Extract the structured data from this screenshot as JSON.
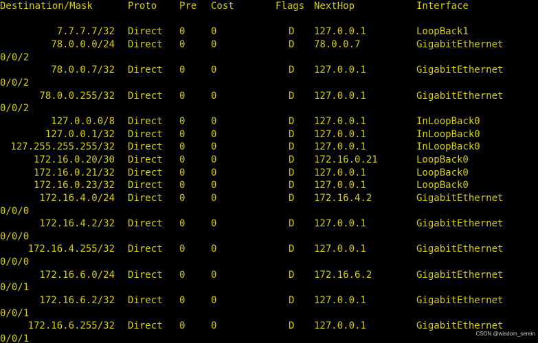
{
  "header": {
    "destination": "Destination/Mask",
    "proto": "Proto",
    "pre": "Pre",
    "cost": "Cost",
    "flags": "Flags",
    "nexthop": "NextHop",
    "interface": "Interface"
  },
  "routes": [
    {
      "dest": "7.7.7.7/32",
      "proto": "Direct",
      "pre": "0",
      "cost": "0",
      "flags": "D",
      "nexthop": "127.0.0.1",
      "iface": "LoopBack1",
      "wrap": ""
    },
    {
      "dest": "78.0.0.0/24",
      "proto": "Direct",
      "pre": "0",
      "cost": "0",
      "flags": "D",
      "nexthop": "78.0.0.7",
      "iface": "GigabitEthernet",
      "wrap": "0/0/2"
    },
    {
      "dest": "78.0.0.7/32",
      "proto": "Direct",
      "pre": "0",
      "cost": "0",
      "flags": "D",
      "nexthop": "127.0.0.1",
      "iface": "GigabitEthernet",
      "wrap": "0/0/2"
    },
    {
      "dest": "78.0.0.255/32",
      "proto": "Direct",
      "pre": "0",
      "cost": "0",
      "flags": "D",
      "nexthop": "127.0.0.1",
      "iface": "GigabitEthernet",
      "wrap": "0/0/2"
    },
    {
      "dest": "127.0.0.0/8",
      "proto": "Direct",
      "pre": "0",
      "cost": "0",
      "flags": "D",
      "nexthop": "127.0.0.1",
      "iface": "InLoopBack0",
      "wrap": ""
    },
    {
      "dest": "127.0.0.1/32",
      "proto": "Direct",
      "pre": "0",
      "cost": "0",
      "flags": "D",
      "nexthop": "127.0.0.1",
      "iface": "InLoopBack0",
      "wrap": ""
    },
    {
      "dest": "127.255.255.255/32",
      "proto": "Direct",
      "pre": "0",
      "cost": "0",
      "flags": "D",
      "nexthop": "127.0.0.1",
      "iface": "InLoopBack0",
      "wrap": ""
    },
    {
      "dest": "172.16.0.20/30",
      "proto": "Direct",
      "pre": "0",
      "cost": "0",
      "flags": "D",
      "nexthop": "172.16.0.21",
      "iface": "LoopBack0",
      "wrap": ""
    },
    {
      "dest": "172.16.0.21/32",
      "proto": "Direct",
      "pre": "0",
      "cost": "0",
      "flags": "D",
      "nexthop": "127.0.0.1",
      "iface": "LoopBack0",
      "wrap": ""
    },
    {
      "dest": "172.16.0.23/32",
      "proto": "Direct",
      "pre": "0",
      "cost": "0",
      "flags": "D",
      "nexthop": "127.0.0.1",
      "iface": "LoopBack0",
      "wrap": ""
    },
    {
      "dest": "172.16.4.0/24",
      "proto": "Direct",
      "pre": "0",
      "cost": "0",
      "flags": "D",
      "nexthop": "172.16.4.2",
      "iface": "GigabitEthernet",
      "wrap": "0/0/0"
    },
    {
      "dest": "172.16.4.2/32",
      "proto": "Direct",
      "pre": "0",
      "cost": "0",
      "flags": "D",
      "nexthop": "127.0.0.1",
      "iface": "GigabitEthernet",
      "wrap": "0/0/0"
    },
    {
      "dest": "172.16.4.255/32",
      "proto": "Direct",
      "pre": "0",
      "cost": "0",
      "flags": "D",
      "nexthop": "127.0.0.1",
      "iface": "GigabitEthernet",
      "wrap": "0/0/0"
    },
    {
      "dest": "172.16.6.0/24",
      "proto": "Direct",
      "pre": "0",
      "cost": "0",
      "flags": "D",
      "nexthop": "172.16.6.2",
      "iface": "GigabitEthernet",
      "wrap": "0/0/1"
    },
    {
      "dest": "172.16.6.2/32",
      "proto": "Direct",
      "pre": "0",
      "cost": "0",
      "flags": "D",
      "nexthop": "127.0.0.1",
      "iface": "GigabitEthernet",
      "wrap": "0/0/1"
    },
    {
      "dest": "172.16.6.255/32",
      "proto": "Direct",
      "pre": "0",
      "cost": "0",
      "flags": "D",
      "nexthop": "127.0.0.1",
      "iface": "GigabitEthernet",
      "wrap": "0/0/1"
    }
  ],
  "watermark": "CSDN @wisdom_serein",
  "colors": {
    "background": "#000000",
    "text": "#d8d000"
  }
}
